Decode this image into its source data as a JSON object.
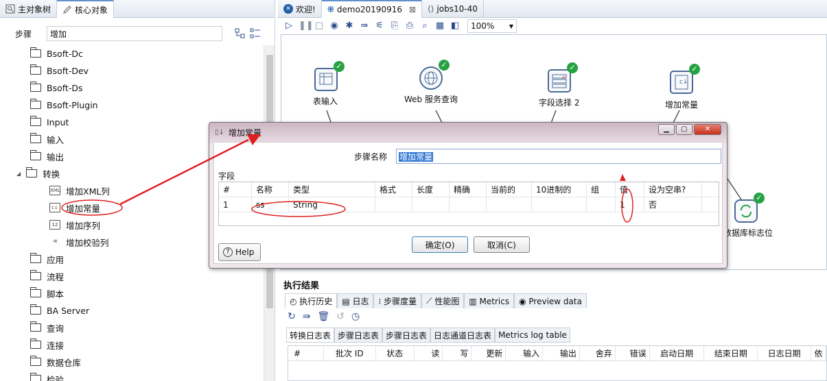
{
  "left_panel": {
    "tabs": [
      "主对象树",
      "核心对象"
    ],
    "steps_label": "步骤",
    "search_value": "增加",
    "tree": [
      {
        "label": "Bsoft-Dc",
        "kind": "folder"
      },
      {
        "label": "Bsoft-Dev",
        "kind": "folder"
      },
      {
        "label": "Bsoft-Ds",
        "kind": "folder"
      },
      {
        "label": "Bsoft-Plugin",
        "kind": "folder"
      },
      {
        "label": "Input",
        "kind": "folder"
      },
      {
        "label": "输入",
        "kind": "folder"
      },
      {
        "label": "输出",
        "kind": "folder"
      },
      {
        "label": "转换",
        "kind": "folder-open"
      },
      {
        "label": "增加XML列",
        "kind": "step"
      },
      {
        "label": "增加常量",
        "kind": "step"
      },
      {
        "label": "增加序列",
        "kind": "step"
      },
      {
        "label": "增加校验列",
        "kind": "step"
      },
      {
        "label": "应用",
        "kind": "folder"
      },
      {
        "label": "流程",
        "kind": "folder"
      },
      {
        "label": "脚本",
        "kind": "folder"
      },
      {
        "label": "BA Server",
        "kind": "folder"
      },
      {
        "label": "查询",
        "kind": "folder"
      },
      {
        "label": "连接",
        "kind": "folder"
      },
      {
        "label": "数据仓库",
        "kind": "folder"
      },
      {
        "label": "检验",
        "kind": "folder"
      }
    ]
  },
  "editor": {
    "tabs": [
      "欢迎!",
      "demo20190916",
      "jobs10-40"
    ],
    "zoom": "100%",
    "nodes": [
      {
        "label": "表输入"
      },
      {
        "label": "Web 服务查询"
      },
      {
        "label": "字段选择 2"
      },
      {
        "label": "增加常量"
      },
      {
        "label": "源数据库标志位"
      }
    ]
  },
  "results": {
    "title": "执行结果",
    "tabs": [
      "执行历史",
      "日志",
      "步骤度量",
      "性能图",
      "Metrics",
      "Preview data"
    ],
    "log_tabs": [
      "转换日志表",
      "步骤日志表",
      "步骤日志表",
      "日志通道日志表",
      "Metrics log table"
    ],
    "columns": [
      "#",
      "批次 ID",
      "状态",
      "读",
      "写",
      "更新",
      "输入",
      "输出",
      "舍弃",
      "错误",
      "启动日期",
      "结束日期",
      "日志日期",
      "依"
    ]
  },
  "dialog": {
    "title": "增加常量",
    "step_name_label": "步骤名称",
    "step_name_value": "增加常量",
    "fields_label": "字段",
    "columns": [
      "#",
      "名称",
      "类型",
      "格式",
      "长度",
      "精确",
      "当前的",
      "10进制的",
      "组",
      "值",
      "设为空串?"
    ],
    "rows": [
      [
        "1",
        "ss",
        "String",
        "",
        "",
        "",
        "",
        "",
        "",
        "1",
        "否"
      ]
    ],
    "help": "Help",
    "ok": "确定(O)",
    "cancel": "取消(C)"
  }
}
